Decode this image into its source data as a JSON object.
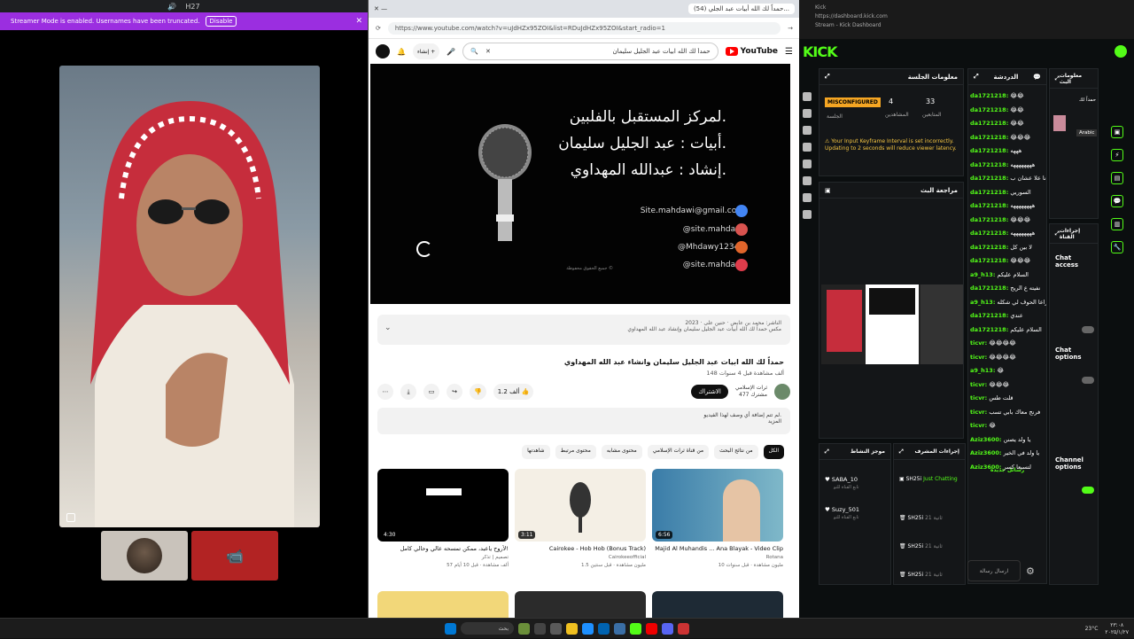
{
  "discord": {
    "top_title": "H27",
    "banner_text": "Streamer Mode is enabled. Usernames have been truncated.",
    "banner_button": "Disable"
  },
  "browser": {
    "tab_title": "(54) حمداً لك الله أبيات عبد الجلي...",
    "url": "https://www.youtube.com/watch?v=uJdHZx95ZOI&list=RDuJdHZx95ZOI&start_radio=1",
    "brand": "YouTube",
    "search_value": "حمداً لك الله ابيات عبد الجليل سليمان",
    "create_label": "إنشاء",
    "video_lines": [
      "لمركز المستقبل بالفلبين.",
      "أبيات : عبد الجليل سليمان.",
      "إنشاد : عبدالله المهداوي."
    ],
    "video_contacts": [
      "Site.mahdawi@gmail.com",
      "@site.mahdawi",
      "@Mhdawy12345",
      "@site.mahdawi"
    ],
    "video_credit": "جميع الحقوق محفوظة ©",
    "desc_line1": "الناشر: محمد بن عابض · حنين على · 2023",
    "desc_line2": "مكس حمداً لك الله أبيات عبد الجليل سليمان وإنشاد عبد الله المهداوي",
    "video_title": "حمداً لك الله ابيات عبد الجليل سليمان وانشاء عبد الله المهداوي",
    "views": "148 ألف مشاهدة قبل 4 سنوات",
    "channel_name": "ثرات الإسلامي",
    "channel_subs": "477 مشترك",
    "subscribe": "الاشتراك",
    "like_count": "1.2 ألف",
    "comment_prompt": "لم تتم إضافة أي وصف لهذا الفيديو.",
    "comment_sub": "المزيد",
    "chips": [
      "الكل",
      "من قناة ثرات الإسلامي",
      "من نتائج البحث",
      "محتوى مشابه",
      "محتوى مرتبط",
      "شاهدتها"
    ],
    "thumbs": [
      {
        "duration": "4:30",
        "title": "لأروح ياعبد، ممكن تمسحه عالي وحالي كامل!",
        "meta1": "تصميم | تذكر",
        "meta2": "57 ألف مشاهدة · قبل 10 أيام"
      },
      {
        "duration": "3:11",
        "title": "Cairokee - Hob Hob (Bonus Track)",
        "meta1": "Cairokeeofficial",
        "meta2": "1.5 مليون مشاهدة · قبل سنتين"
      },
      {
        "duration": "6:56",
        "title": "Majid Al Muhandis ... Ana Blayak - Video Clip",
        "meta1": "Rotana",
        "meta2": "10 مليون مشاهدة · قبل سنوات"
      }
    ]
  },
  "kick": {
    "window_title": "Kick",
    "url": "https://dashboard.kick.com",
    "page_title": "Stream - Kick Dashboard",
    "logo": "KICK",
    "session_title": "معلومات الجلسة",
    "stat_badge": "MISCONFIGURED",
    "stat_session_label": "الجلسة",
    "stat_viewers_value": "4",
    "stat_viewers_label": "المشاهدين",
    "stat_followers_value": "33",
    "stat_followers_label": "المتابعين",
    "warning": "Your Input Keyframe Interval is set incorrectly. Updating to 2 seconds will reduce viewer latency.",
    "preview_title": "مراجعة البث",
    "chat_title": "الدردشة",
    "chat": [
      {
        "name": "da1721218",
        "text": "😂😂"
      },
      {
        "name": "da1721218",
        "text": "😂😂"
      },
      {
        "name": "da1721218",
        "text": "😂😂"
      },
      {
        "name": "da1721218",
        "text": "😂😂😂"
      },
      {
        "name": "da1721218",
        "text": "هههه"
      },
      {
        "name": "da1721218",
        "text": "ههههههههه"
      },
      {
        "name": "da1721218",
        "text": "انا علا عشان ب"
      },
      {
        "name": "da1721218",
        "text": "السوريي"
      },
      {
        "name": "da1721218",
        "text": "ههههههههه"
      },
      {
        "name": "da1721218",
        "text": "😂😂😂"
      },
      {
        "name": "da1721218",
        "text": "ههههههههه"
      },
      {
        "name": "da1721218",
        "text": "لا بين كل"
      },
      {
        "name": "da1721218",
        "text": "😂😂😂"
      },
      {
        "name": "a9_h13",
        "text": "السلام عليكم"
      },
      {
        "name": "da1721218",
        "text": "نفيته ع الريح"
      },
      {
        "name": "a9_h13",
        "text": "راعا الحوف لي شكله"
      },
      {
        "name": "da1721218",
        "text": "عندي"
      },
      {
        "name": "da1721218",
        "text": "السلام عليكم"
      },
      {
        "name": "ticvr",
        "text": "😂😂😂😂"
      },
      {
        "name": "ticvr",
        "text": "😂😂😂😂"
      },
      {
        "name": "a9_h13",
        "text": "😂"
      },
      {
        "name": "ticvr",
        "text": "😂😂😂"
      },
      {
        "name": "ticvr",
        "text": "قلت طس"
      },
      {
        "name": "ticvr",
        "text": "فرنج معاك بابي تسب"
      },
      {
        "name": "ticvr",
        "text": "😂"
      },
      {
        "name": "Aziz3600",
        "text": "يا ولد يصنن"
      },
      {
        "name": "Aziz3600",
        "text": "يا ولد في الخير"
      },
      {
        "name": "Aziz3600",
        "text": "لتسيعا كسر"
      }
    ],
    "chat_pinned": "رسائل جديدة",
    "stream_info_title": "معلومات البث",
    "stream_info_name": "حمداً لك",
    "stream_info_lang": "Arabic",
    "actions_title": "إجراءات القناة",
    "chat_access": "Chat access",
    "chat_options": "Chat options",
    "channel_options": "Channel options",
    "mod_title": "إجراءات المشرف",
    "log_title": "موجز النشاط",
    "log": [
      {
        "name": "SABA_10",
        "text": "تابع القناة للتو"
      },
      {
        "name": "Suzy_501",
        "text": "تابع القناة للتو"
      }
    ],
    "mod_entries": [
      {
        "name": "SH25i",
        "text": "Just Chatting"
      },
      {
        "name": "SH25i",
        "text": "21 ثانية"
      },
      {
        "name": "SH25i",
        "text": "21 ثانية"
      },
      {
        "name": "SH25i",
        "text": "21 ثانية"
      }
    ],
    "send_label": "ارسال رسالة"
  },
  "taskbar": {
    "search": "بحث",
    "clock_time": "٢٣:٠٨",
    "clock_date": "٢٠٢٥/١/٢٧",
    "weather": "23°C"
  }
}
